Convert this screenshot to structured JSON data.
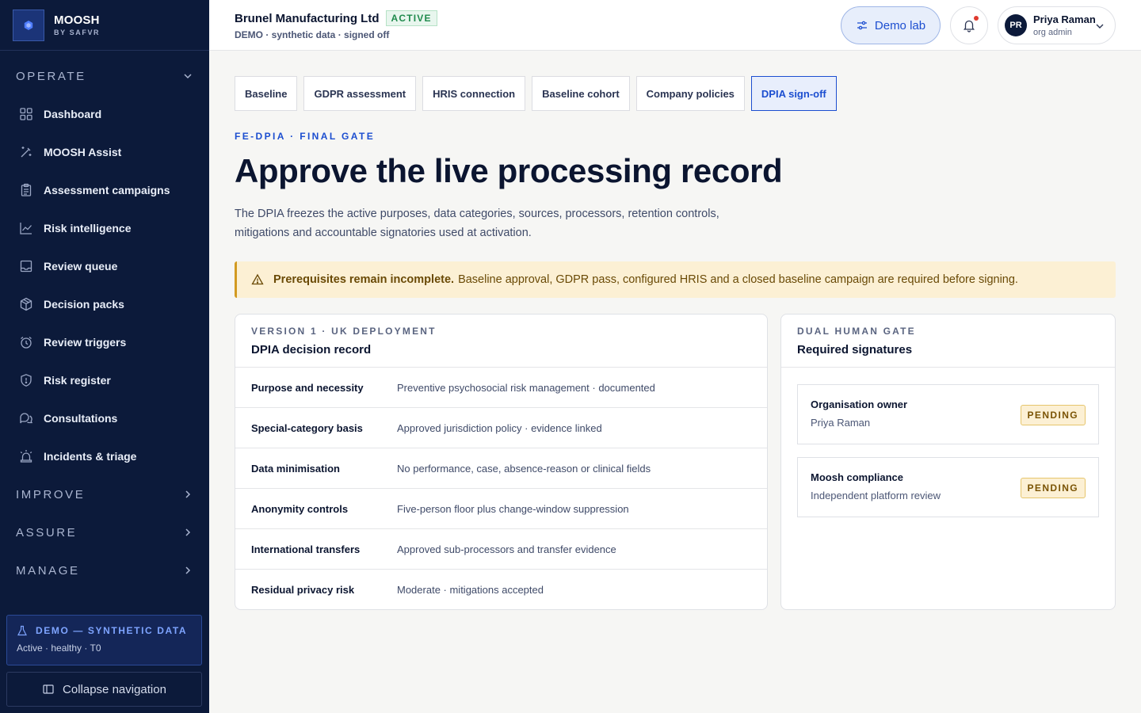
{
  "brand": {
    "name": "MOOSH",
    "sub": "BY SAFVR"
  },
  "sidebar": {
    "operate_label": "OPERATE",
    "items": [
      {
        "label": "Dashboard",
        "icon": "grid-icon"
      },
      {
        "label": "MOOSH Assist",
        "icon": "magic-wand-icon"
      },
      {
        "label": "Assessment campaigns",
        "icon": "clipboard-icon"
      },
      {
        "label": "Risk intelligence",
        "icon": "trend-chart-icon"
      },
      {
        "label": "Review queue",
        "icon": "inbox-icon"
      },
      {
        "label": "Decision packs",
        "icon": "package-icon"
      },
      {
        "label": "Review triggers",
        "icon": "alarm-clock-icon"
      },
      {
        "label": "Risk register",
        "icon": "shield-icon"
      },
      {
        "label": "Consultations",
        "icon": "chat-bubbles-icon"
      },
      {
        "label": "Incidents & triage",
        "icon": "siren-icon"
      }
    ],
    "improve_label": "IMPROVE",
    "assure_label": "ASSURE",
    "manage_label": "MANAGE",
    "demo_title": "DEMO — SYNTHETIC DATA",
    "demo_status": "Active · healthy · T0",
    "collapse_label": "Collapse navigation"
  },
  "topbar": {
    "org_name": "Brunel Manufacturing Ltd",
    "status_badge": "ACTIVE",
    "org_sub": "DEMO · synthetic data · signed off",
    "demo_lab_label": "Demo lab",
    "user_initials": "PR",
    "user_name": "Priya Raman",
    "user_role": "org admin"
  },
  "tabs": [
    "Baseline",
    "GDPR assessment",
    "HRIS connection",
    "Baseline cohort",
    "Company policies",
    "DPIA sign-off"
  ],
  "active_tab": "DPIA sign-off",
  "main": {
    "eyebrow": "FE-DPIA · FINAL GATE",
    "title": "Approve the live processing record",
    "description": "The DPIA freezes the active purposes, data categories, sources, processors, retention controls, mitigations and accountable signatories used at activation."
  },
  "alert": {
    "strong": "Prerequisites remain incomplete.",
    "text": "Baseline approval, GDPR pass, configured HRIS and a closed baseline campaign are required before signing."
  },
  "record": {
    "eyebrow": "VERSION 1 · UK DEPLOYMENT",
    "title": "DPIA decision record",
    "rows": [
      {
        "key": "Purpose and necessity",
        "value": "Preventive psychosocial risk management · documented"
      },
      {
        "key": "Special-category basis",
        "value": "Approved jurisdiction policy · evidence linked"
      },
      {
        "key": "Data minimisation",
        "value": "No performance, case, absence-reason or clinical fields"
      },
      {
        "key": "Anonymity controls",
        "value": "Five-person floor plus change-window suppression"
      },
      {
        "key": "International transfers",
        "value": "Approved sub-processors and transfer evidence"
      },
      {
        "key": "Residual privacy risk",
        "value": "Moderate · mitigations accepted"
      }
    ]
  },
  "signatures": {
    "eyebrow": "DUAL HUMAN GATE",
    "title": "Required signatures",
    "items": [
      {
        "role": "Organisation owner",
        "name": "Priya Raman",
        "status": "PENDING"
      },
      {
        "role": "Moosh compliance",
        "name": "Independent platform review",
        "status": "PENDING"
      }
    ]
  },
  "colors": {
    "sidebar_bg": "#0c1a3a",
    "accent": "#1c4ed0",
    "success": "#1f8a4c",
    "warning_bg": "#fcf0d4",
    "warning_border": "#d29a21"
  }
}
